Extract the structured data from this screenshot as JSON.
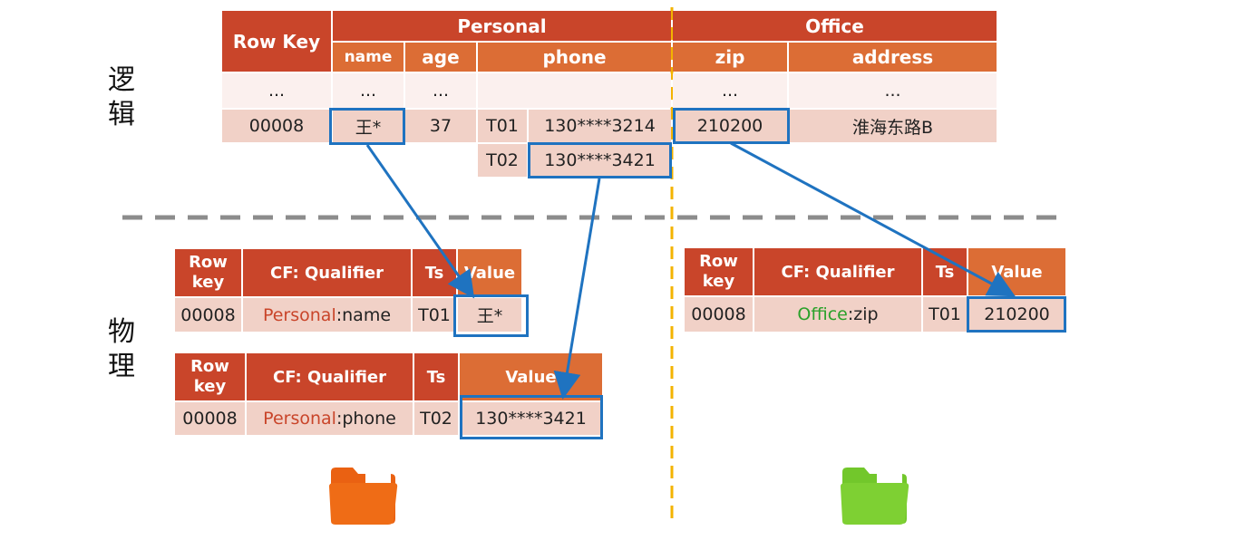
{
  "side_labels": {
    "logical": "逻\n辑",
    "physical": "物\n理"
  },
  "logical_table": {
    "rowkey_header": "Row Key",
    "families": [
      {
        "name": "Personal"
      },
      {
        "name": "Office"
      }
    ],
    "qualifiers": [
      "name",
      "age",
      "phone",
      "zip",
      "address"
    ],
    "ellipsis": "...",
    "row": {
      "rowkey": "00008",
      "name": "王*",
      "age": "37",
      "zip": "210200",
      "address": "淮海东路B"
    },
    "phones": [
      {
        "ts": "T01",
        "value": "130****3214"
      },
      {
        "ts": "T02",
        "value": "130****3421"
      }
    ]
  },
  "physical_tables": {
    "headers": {
      "rowkey": "Row\nkey",
      "cf_qualifier": "CF: Qualifier",
      "ts": "Ts",
      "value": "Value"
    },
    "tables": [
      {
        "rowkey": "00008",
        "family": "Personal",
        "qualifier": ":name",
        "ts": "T01",
        "value": "王*"
      },
      {
        "rowkey": "00008",
        "family": "Personal",
        "qualifier": ":phone",
        "ts": "T02",
        "value": "130****3421"
      },
      {
        "rowkey": "00008",
        "family": "Office",
        "qualifier": ":zip",
        "ts": "T01",
        "value": "210200"
      }
    ]
  },
  "colors": {
    "header_dark": "#c9452a",
    "header_light": "#dc6d35",
    "cell_light": "#fbf0ee",
    "cell_pink": "#f1d1c7",
    "highlight": "#1f73c0",
    "divider_dashed": "#8c8c8c",
    "divider_vertical": "#f3b300",
    "personal_text": "#c9452a",
    "office_text": "#2aa12a",
    "personal_folder": "#ea6112",
    "office_folder": "#72c72b"
  },
  "icons": {
    "personal_folder": "folder-icon",
    "office_folder": "folder-icon"
  }
}
